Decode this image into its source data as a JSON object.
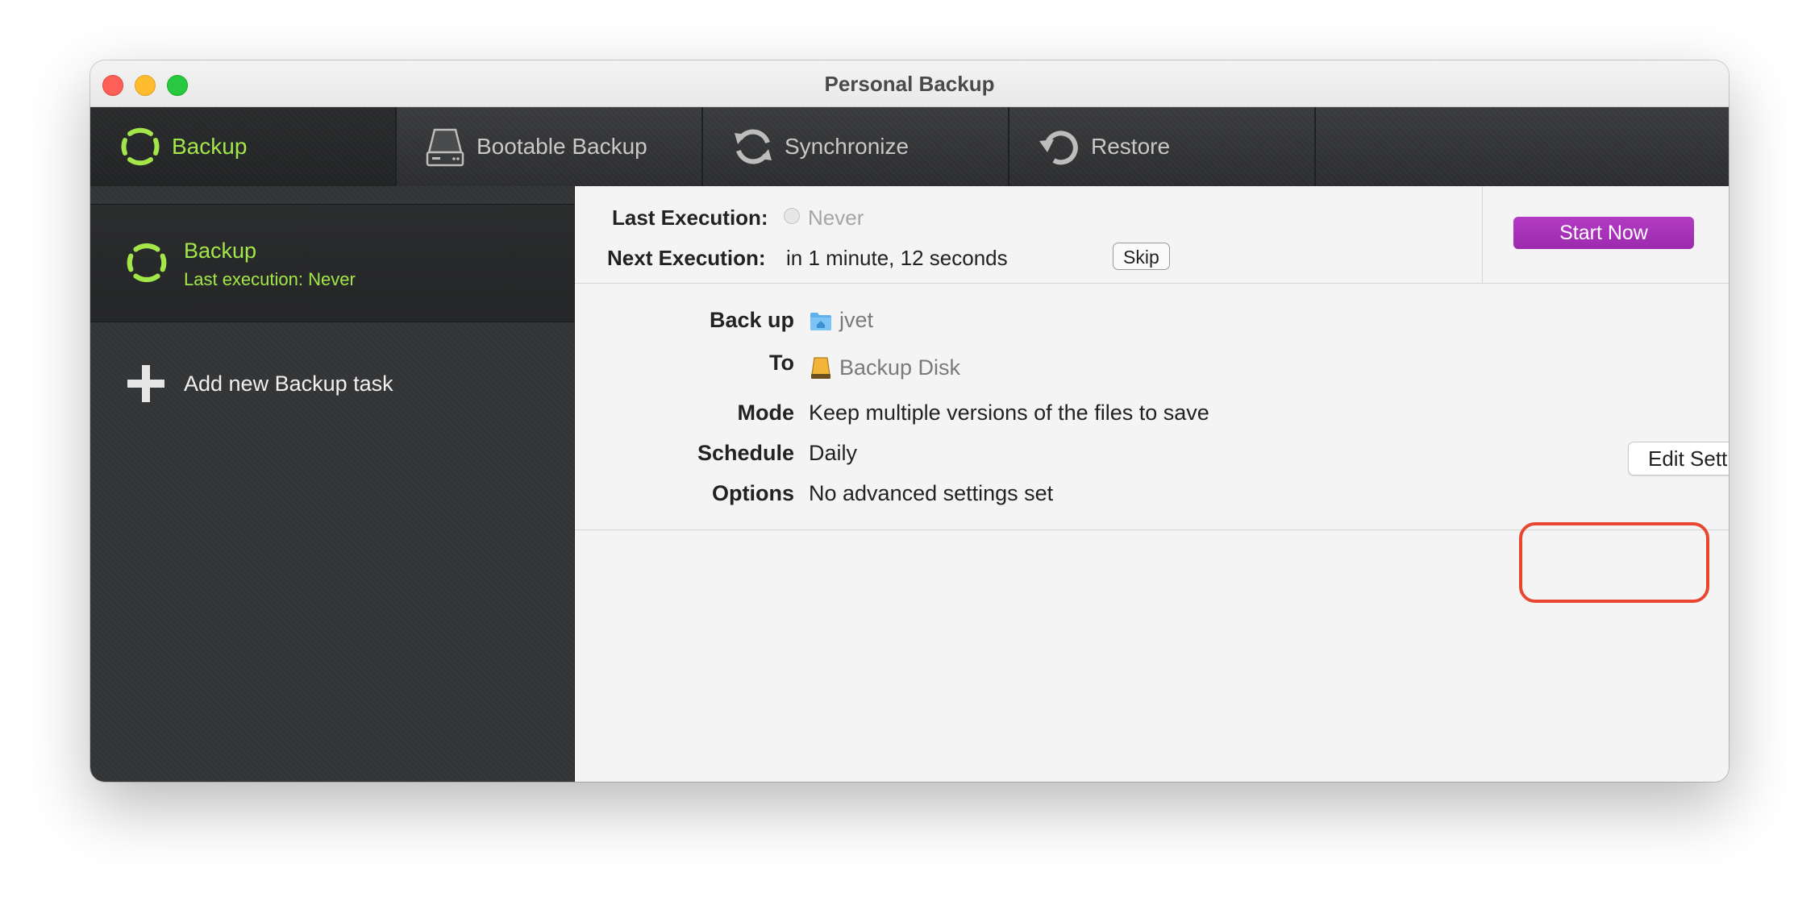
{
  "window": {
    "title": "Personal Backup"
  },
  "tabs": [
    {
      "label": "Backup",
      "icon": "backup-ring-icon",
      "active": true
    },
    {
      "label": "Bootable Backup",
      "icon": "drive-icon",
      "active": false
    },
    {
      "label": "Synchronize",
      "icon": "sync-icon",
      "active": false
    },
    {
      "label": "Restore",
      "icon": "restore-icon",
      "active": false
    }
  ],
  "sidebar": {
    "task": {
      "name": "Backup",
      "subtitle": "Last execution: Never"
    },
    "add_label": "Add new Backup task"
  },
  "execution": {
    "last_label": "Last Execution:",
    "last_value": "Never",
    "next_label": "Next Execution:",
    "next_value": "in 1 minute, 12 seconds",
    "skip_label": "Skip",
    "start_label": "Start Now"
  },
  "details": {
    "backup_label": "Back up",
    "backup_value": "jvet",
    "to_label": "To",
    "to_value": "Backup Disk",
    "mode_label": "Mode",
    "mode_value": "Keep multiple versions of the files to save",
    "schedule_label": "Schedule",
    "schedule_value": "Daily",
    "options_label": "Options",
    "options_value": "No advanced settings set"
  },
  "edit_label": "Edit Settings",
  "colors": {
    "accent_green": "#a3e64a",
    "start_purple": "#a533b8",
    "highlight_red": "#e8462f"
  }
}
